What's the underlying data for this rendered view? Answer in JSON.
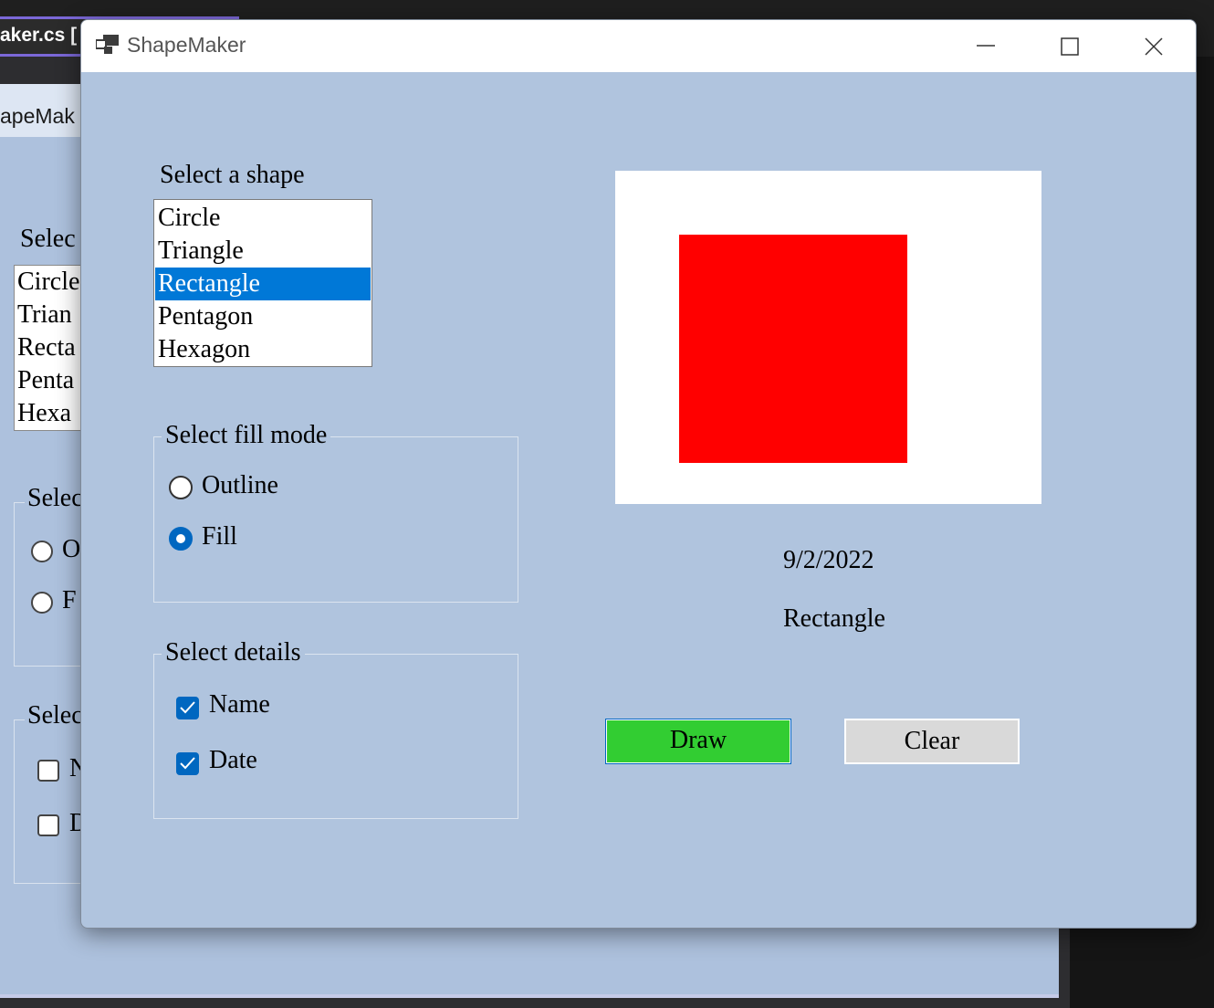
{
  "ide": {
    "tab_label": "aker.cs [",
    "designer_title": "apeMak",
    "bg_select_shape": "Selec",
    "bg_items": [
      "Circle",
      "Trian",
      "Recta",
      "Penta",
      "Hexa"
    ],
    "bg_fill_mode": "Selec",
    "bg_outline": "O",
    "bg_fill": "F",
    "bg_details": "Selec",
    "bg_name": "N",
    "bg_date": "D"
  },
  "window": {
    "title": "ShapeMaker",
    "icon": "app-window-icon",
    "controls": [
      "minimize-icon",
      "maximize-icon",
      "close-icon"
    ]
  },
  "shape_selector": {
    "label": "Select a shape",
    "items": [
      {
        "label": "Circle",
        "selected": false
      },
      {
        "label": "Triangle",
        "selected": false
      },
      {
        "label": "Rectangle",
        "selected": true
      },
      {
        "label": "Pentagon",
        "selected": false
      },
      {
        "label": "Hexagon",
        "selected": false
      }
    ]
  },
  "fill_mode": {
    "legend": "Select fill mode",
    "options": [
      {
        "label": "Outline",
        "checked": false
      },
      {
        "label": "Fill",
        "checked": true
      }
    ]
  },
  "details": {
    "legend": "Select details",
    "options": [
      {
        "label": "Name",
        "checked": true
      },
      {
        "label": "Date",
        "checked": true
      }
    ]
  },
  "preview": {
    "shape": "rectangle",
    "fill_color": "#ff0000",
    "background": "#ffffff"
  },
  "info": {
    "date": "9/2/2022",
    "shape_name": "Rectangle"
  },
  "buttons": {
    "draw_label": "Draw",
    "clear_label": "Clear",
    "draw_color": "#32cd32",
    "clear_color": "#d9d9d9"
  },
  "colors": {
    "form_background": "#b0c4de",
    "selection": "#0078d7",
    "accent": "#0067c0"
  }
}
